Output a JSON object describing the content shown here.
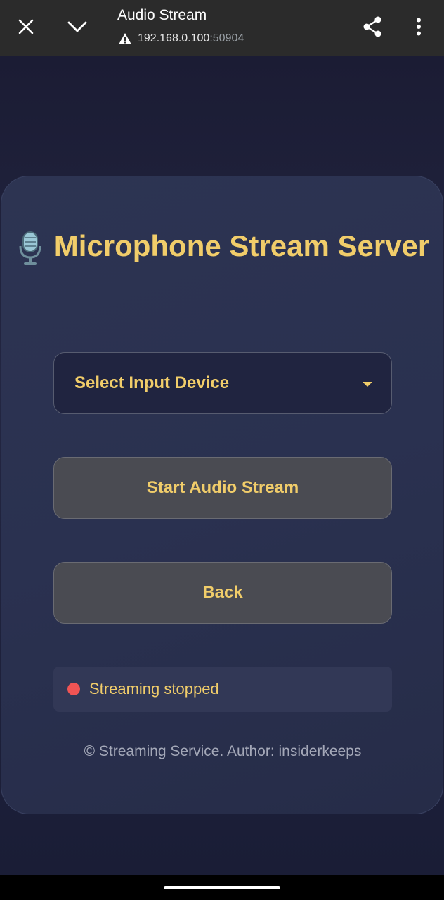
{
  "browser": {
    "title": "Audio Stream",
    "url_host": "192.168.0.100",
    "url_port": ":50904"
  },
  "card": {
    "heading": "Microphone Stream Server",
    "select_label": "Select Input Device",
    "start_button": "Start Audio Stream",
    "back_button": "Back",
    "status_text": "Streaming stopped",
    "footer": "© Streaming Service. Author: insiderkeeps"
  },
  "colors": {
    "accent": "#f1cd6a",
    "status_stopped": "#f05454",
    "card_bg": "#2a3150",
    "button_bg": "#4a4b52"
  },
  "icons": {
    "close": "close-icon",
    "chevron": "chevron-down-icon",
    "share": "share-icon",
    "more": "more-vert-icon",
    "warning": "warning-icon",
    "microphone": "microphone-icon"
  }
}
